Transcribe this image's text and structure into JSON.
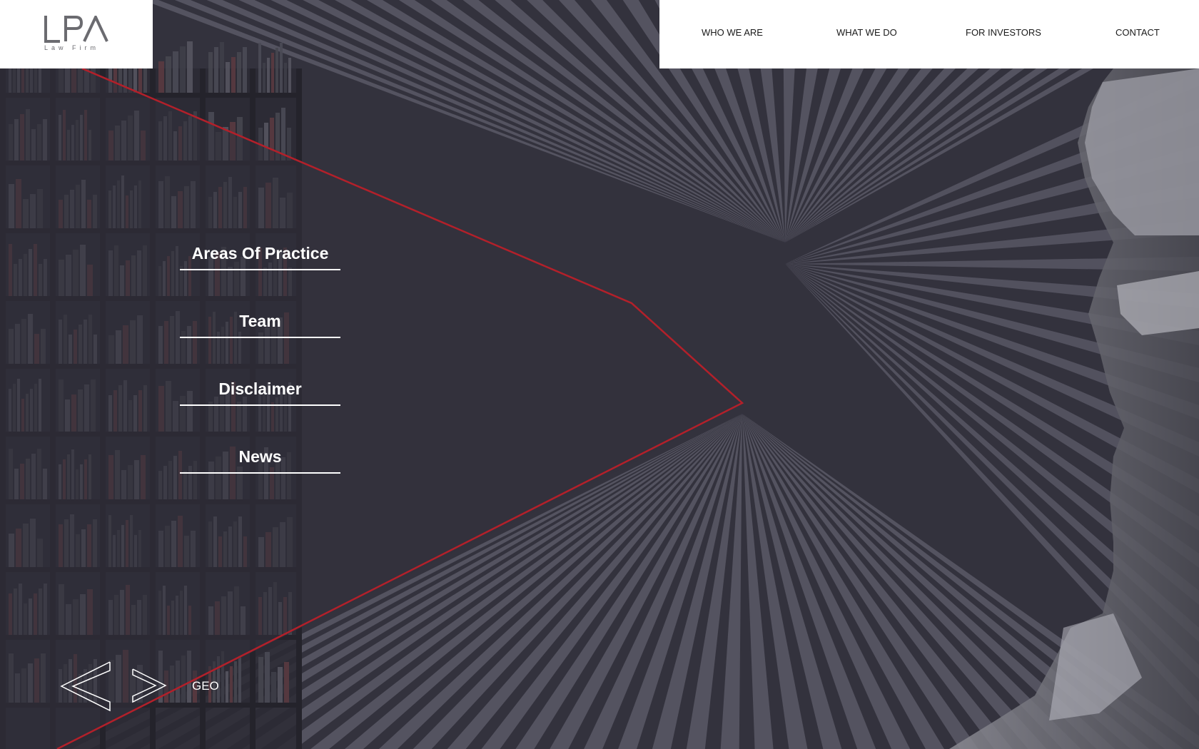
{
  "logo": {
    "mark": "LPA",
    "subtitle": "Law Firm"
  },
  "top_nav": {
    "items": [
      {
        "label": "WHO WE ARE"
      },
      {
        "label": "WHAT WE DO"
      },
      {
        "label": "FOR INVESTORS"
      },
      {
        "label": "CONTACT"
      }
    ]
  },
  "side_menu": {
    "items": [
      {
        "label": "Areas Of Practice"
      },
      {
        "label": "Team"
      },
      {
        "label": "Disclaimer"
      },
      {
        "label": "News"
      }
    ]
  },
  "footer": {
    "prev_icon": "chevron-left-icon",
    "next_icon": "chevron-right-icon",
    "language_label": "GEO"
  },
  "colors": {
    "background": "#33323d",
    "stripe": "#5a5966",
    "accent_red": "#b3202a",
    "white": "#ffffff"
  }
}
